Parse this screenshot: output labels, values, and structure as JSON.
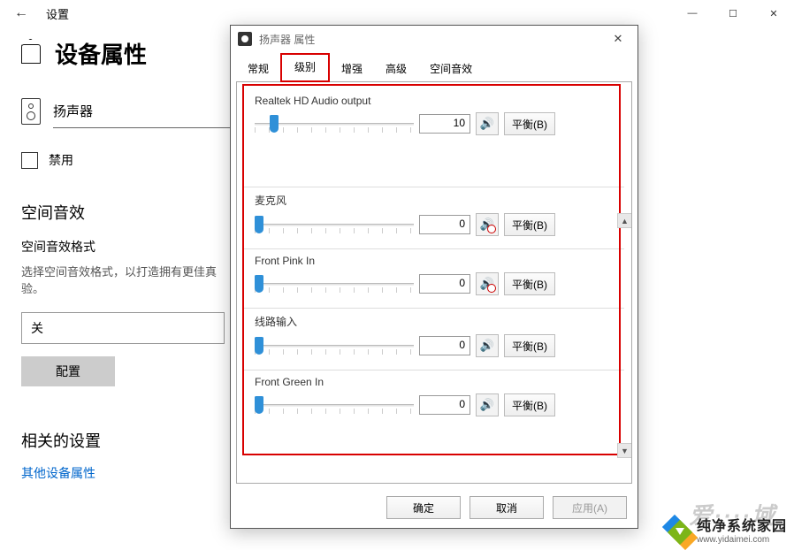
{
  "main": {
    "back": "←",
    "title": "设置",
    "min": "—",
    "max": "☐",
    "close": "✕"
  },
  "settings": {
    "title": "设备属性",
    "device_name": "扬声器",
    "disable": "禁用",
    "spatial_title": "空间音效",
    "spatial_sub": "空间音效格式",
    "spatial_desc": "选择空间音效格式，以打造拥有更佳真验。",
    "spatial_value": "关",
    "config_btn": "配置",
    "related_title": "相关的设置",
    "related_link": "其他设备属性"
  },
  "dialog": {
    "title": "扬声器 属性",
    "close": "✕",
    "tabs": [
      "常规",
      "级别",
      "增强",
      "高级",
      "空间音效"
    ],
    "active_tab": 1,
    "channels": [
      {
        "name": "Realtek HD Audio output",
        "value": "10",
        "pct": 10,
        "muted": false,
        "balance": "平衡(B)"
      },
      {
        "name": "麦克风",
        "value": "0",
        "pct": 0,
        "muted": true,
        "balance": "平衡(B)"
      },
      {
        "name": "Front Pink In",
        "value": "0",
        "pct": 0,
        "muted": true,
        "balance": "平衡(B)"
      },
      {
        "name": "线路输入",
        "value": "0",
        "pct": 0,
        "muted": false,
        "balance": "平衡(B)"
      },
      {
        "name": "Front Green In",
        "value": "0",
        "pct": 0,
        "muted": false,
        "balance": "平衡(B)"
      }
    ],
    "ok": "确定",
    "cancel": "取消",
    "apply": "应用(A)"
  },
  "watermark": {
    "cn": "纯净系统家园",
    "url": "www.yidaimei.com"
  }
}
